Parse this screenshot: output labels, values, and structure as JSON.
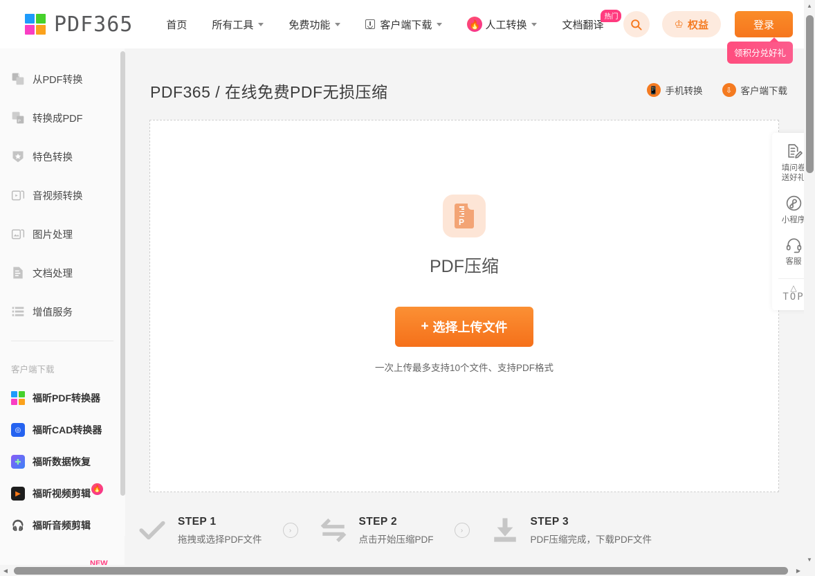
{
  "header": {
    "logo_text": "PDF365",
    "logo_colors": [
      "#1e9bfb",
      "#46d12b",
      "#f93ec3",
      "#fba21c"
    ],
    "nav": [
      {
        "label": "首页",
        "caret": false,
        "icon": "",
        "badge": ""
      },
      {
        "label": "所有工具",
        "caret": true,
        "icon": "",
        "badge": ""
      },
      {
        "label": "免费功能",
        "caret": true,
        "icon": "",
        "badge": ""
      },
      {
        "label": "客户端下载",
        "caret": true,
        "icon": "download-box-icon",
        "badge": ""
      },
      {
        "label": "人工转换",
        "caret": true,
        "icon": "flame-icon",
        "badge": ""
      },
      {
        "label": "文档翻译",
        "caret": false,
        "icon": "",
        "badge": "热门"
      }
    ],
    "search_icon": "search-icon",
    "benefit_label": "权益",
    "benefit_icon": "crown-icon",
    "login_label": "登录",
    "tip": "领积分兑好礼",
    "accent": "#f5761b",
    "pink": "#ff3b7f"
  },
  "sidebar": {
    "items": [
      {
        "label": "从PDF转换",
        "icon": "from-pdf-icon"
      },
      {
        "label": "转换成PDF",
        "icon": "to-pdf-icon"
      },
      {
        "label": "特色转换",
        "icon": "star-shield-icon"
      },
      {
        "label": "音视频转换",
        "icon": "media-icon"
      },
      {
        "label": "图片处理",
        "icon": "image-icon"
      },
      {
        "label": "文档处理",
        "icon": "document-icon"
      },
      {
        "label": "增值服务",
        "icon": "list-icon"
      }
    ],
    "downloads_heading": "客户端下载",
    "apps": [
      {
        "label": "福昕PDF转换器",
        "icon": "foxit-pdf-icon",
        "badge": ""
      },
      {
        "label": "福昕CAD转换器",
        "icon": "foxit-cad-icon",
        "badge": ""
      },
      {
        "label": "福昕数据恢复",
        "icon": "foxit-recovery-icon",
        "badge": ""
      },
      {
        "label": "福昕视频剪辑",
        "icon": "foxit-video-icon",
        "badge": "flame-icon"
      },
      {
        "label": "福昕音频剪辑",
        "icon": "foxit-audio-icon",
        "badge": ""
      }
    ],
    "new_tag": "NEW"
  },
  "main": {
    "title": "PDF365 / 在线免费PDF无损压缩",
    "title_actions": [
      {
        "label": "手机转换",
        "icon": "phone-icon"
      },
      {
        "label": "客户端下载",
        "icon": "download-icon"
      }
    ],
    "tool_name": "PDF压缩",
    "tool_icon": "pdf-compress-icon",
    "upload_label": "选择上传文件",
    "upload_plus": "+",
    "upload_hint": "一次上传最多支持10个文件、支持PDF格式",
    "steps": [
      {
        "num": "STEP 1",
        "desc": "拖拽或选择PDF文件",
        "icon": "check-icon"
      },
      {
        "num": "STEP 2",
        "desc": "点击开始压缩PDF",
        "icon": "exchange-icon"
      },
      {
        "num": "STEP 3",
        "desc": "PDF压缩完成，下载PDF文件",
        "icon": "download-tray-icon"
      }
    ],
    "step_arrow": "›"
  },
  "rail": {
    "items": [
      {
        "label": "填问卷\n送好礼",
        "icon": "survey-icon"
      },
      {
        "label": "小程序",
        "icon": "miniprogram-icon"
      },
      {
        "label": "客服",
        "icon": "headset-icon"
      }
    ],
    "top_label": "TOP",
    "top_icon": "chevron-up-icon"
  }
}
